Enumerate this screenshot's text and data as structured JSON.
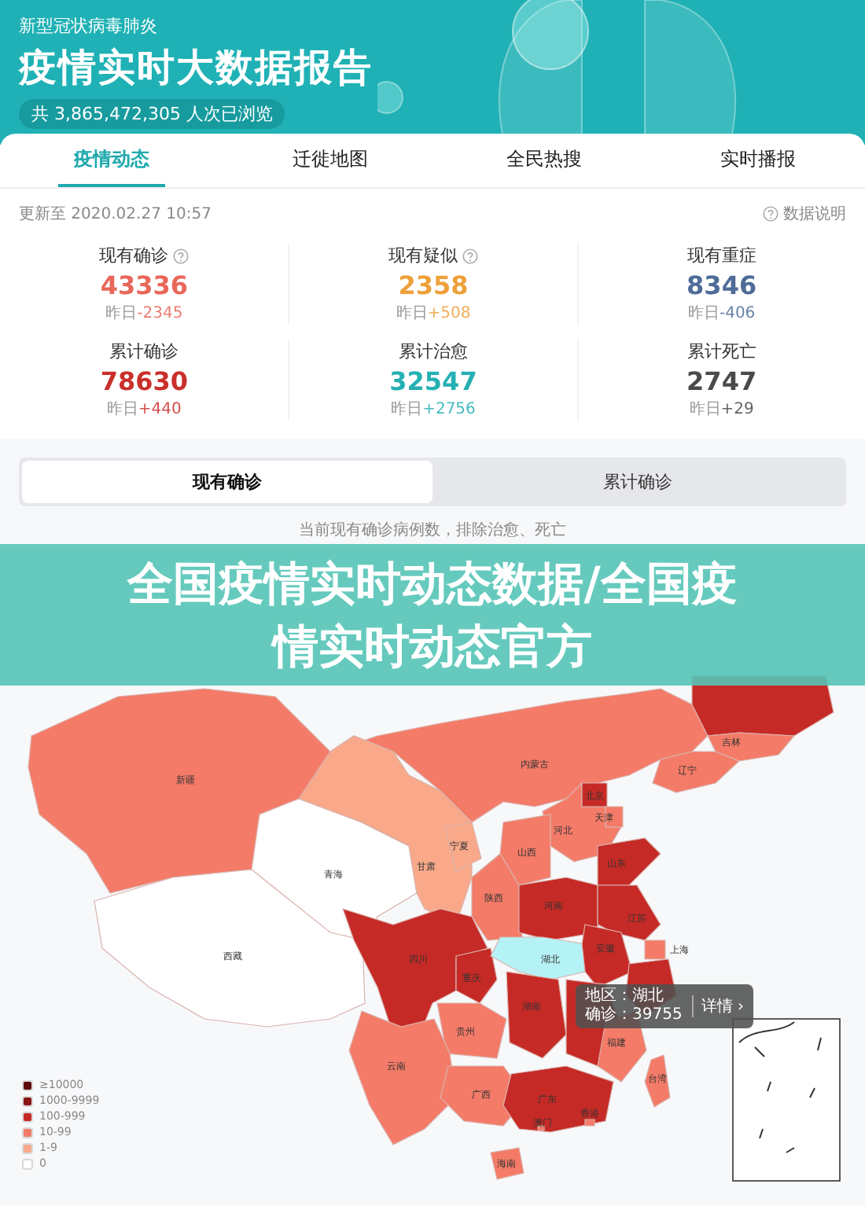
{
  "header": {
    "subtitle": "新型冠状病毒肺炎",
    "title": "疫情实时大数据报告",
    "views": "共 3,865,472,305 人次已浏览"
  },
  "tabs": [
    {
      "label": "疫情动态",
      "selected": true
    },
    {
      "label": "迁徙地图",
      "selected": false
    },
    {
      "label": "全民热搜",
      "selected": false
    },
    {
      "label": "实时播报",
      "selected": false
    }
  ],
  "update_time": "更新至 2020.02.27 10:57",
  "data_note_link": "数据说明",
  "stats": [
    {
      "label": "现有确诊",
      "has_info": true,
      "value": "43336",
      "delta_label": "昨日",
      "delta": "-2345",
      "color": "#e8685a"
    },
    {
      "label": "现有疑似",
      "has_info": true,
      "value": "2358",
      "delta_label": "昨日",
      "delta": "+508",
      "color": "#eea03a"
    },
    {
      "label": "现有重症",
      "has_info": false,
      "value": "8346",
      "delta_label": "昨日",
      "delta": "-406",
      "color": "#4e6c98"
    },
    {
      "label": "累计确诊",
      "has_info": false,
      "value": "78630",
      "delta_label": "昨日",
      "delta": "+440",
      "color": "#c9302c"
    },
    {
      "label": "累计治愈",
      "has_info": false,
      "value": "32547",
      "delta_label": "昨日",
      "delta": "+2756",
      "color": "#25b0b3"
    },
    {
      "label": "累计死亡",
      "has_info": false,
      "value": "2747",
      "delta_label": "昨日",
      "delta": "+29",
      "color": "#4a4a4a"
    }
  ],
  "segments": [
    {
      "label": "现有确诊",
      "selected": true
    },
    {
      "label": "累计确诊",
      "selected": false
    }
  ],
  "map": {
    "caption": "当前现有确诊病例数，排除治愈、死亡",
    "regions": [
      {
        "name": "新疆",
        "color": "#f47b68"
      },
      {
        "name": "西藏",
        "color": "#ffffff"
      },
      {
        "name": "青海",
        "color": "#ffffff"
      },
      {
        "name": "内蒙古",
        "color": "#f47b68"
      },
      {
        "name": "甘肃",
        "color": "#f9a98a"
      },
      {
        "name": "宁夏",
        "color": "#f9a98a"
      },
      {
        "color": "#c62a26"
      },
      {
        "name": "吉林",
        "color": "#f47b68"
      },
      {
        "name": "辽宁",
        "color": "#f47b68"
      },
      {
        "name": "河北",
        "color": "#f47b68"
      },
      {
        "name": "北京",
        "color": "#c62a26"
      },
      {
        "name": "天津",
        "color": "#f47b68"
      },
      {
        "name": "山西",
        "color": "#f47b68"
      },
      {
        "name": "陕西",
        "color": "#f47b68"
      },
      {
        "name": "山东",
        "color": "#c62a26"
      },
      {
        "name": "河南",
        "color": "#c62a26"
      },
      {
        "name": "江苏",
        "color": "#c62a26"
      },
      {
        "name": "安徽",
        "color": "#c62a26"
      },
      {
        "name": "上海",
        "color": "#f47b68"
      },
      {
        "color": "#c62a26"
      },
      {
        "name": "四川",
        "color": "#c62a26"
      },
      {
        "name": "重庆",
        "color": "#c62a26"
      },
      {
        "name": "湖北",
        "color": "#b5f2f5"
      },
      {
        "name": "贵州",
        "color": "#f47b68"
      },
      {
        "name": "湖南",
        "color": "#c62a26"
      },
      {
        "color": "#c62a26"
      },
      {
        "name": "福建",
        "color": "#f47b68"
      },
      {
        "name": "云南",
        "color": "#f47b68"
      },
      {
        "name": "广西",
        "color": "#f47b68"
      },
      {
        "name": "广东",
        "color": "#c62a26"
      },
      {
        "name": "香港",
        "color": "#f47b68"
      },
      {
        "name": "澳门",
        "color": "#f47b68"
      },
      {
        "name": "台湾",
        "color": "#f47b68"
      },
      {
        "name": "海南",
        "color": "#f47b68"
      }
    ],
    "legend": [
      {
        "label": "≥10000",
        "color": "#5c0a0a"
      },
      {
        "label": "1000-9999",
        "color": "#8c1414"
      },
      {
        "label": "100-999",
        "color": "#c62a26"
      },
      {
        "label": "10-99",
        "color": "#f47b68"
      },
      {
        "label": "1-9",
        "color": "#f9a98a"
      },
      {
        "label": "0",
        "color": "#ffffff"
      }
    ],
    "tooltip": {
      "region": "地区：湖北",
      "confirmed": "确诊：39755",
      "details": "详情",
      "arrow": "›"
    }
  },
  "banner": {
    "text": "全国疫情实时动态数据/全国疫情实时动态官方"
  }
}
